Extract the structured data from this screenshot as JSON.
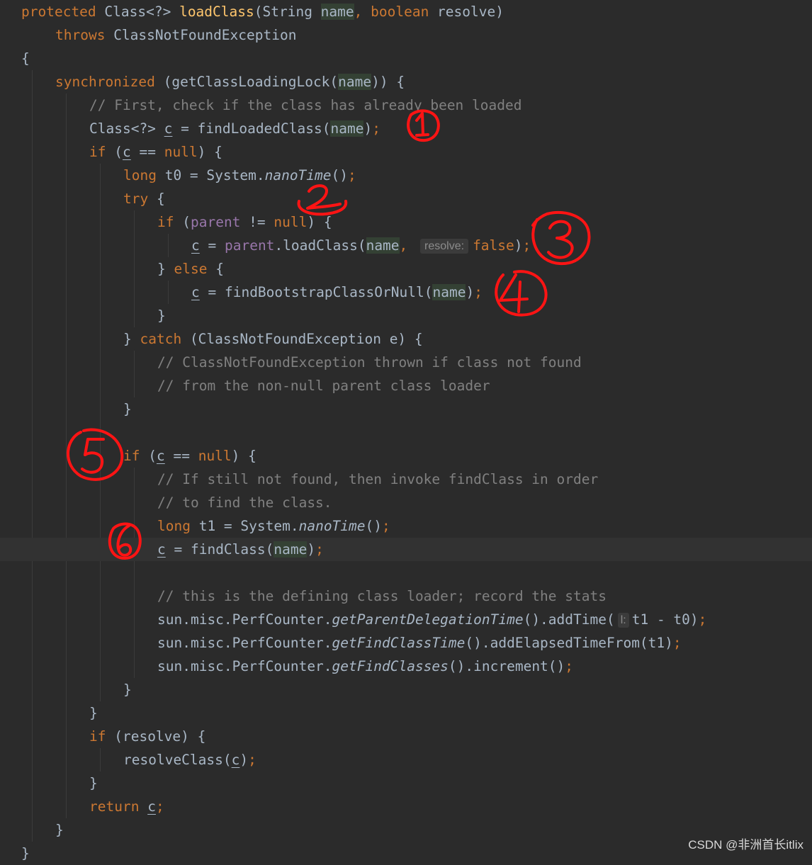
{
  "colors": {
    "background": "#2b2b2b",
    "keyword": "#cc7832",
    "text": "#a9b7c6",
    "method_decl": "#ffc66d",
    "field": "#9876aa",
    "comment": "#808080",
    "param_highlight": "#344134",
    "annotation_ink": "#ff1414"
  },
  "code_lines": [
    {
      "indent": 0,
      "tokens": [
        {
          "t": "protected ",
          "c": "keyword"
        },
        {
          "t": "Class<?> ",
          "c": "text"
        },
        {
          "t": "loadClass",
          "c": "method_decl"
        },
        {
          "t": "(String ",
          "c": "text"
        },
        {
          "t": "name",
          "c": "text",
          "param": true
        },
        {
          "t": ", ",
          "c": "keyword"
        },
        {
          "t": "boolean ",
          "c": "keyword"
        },
        {
          "t": "resolve)",
          "c": "text"
        }
      ]
    },
    {
      "indent": 1,
      "tokens": [
        {
          "t": "throws ",
          "c": "keyword"
        },
        {
          "t": "ClassNotFoundException",
          "c": "text"
        }
      ]
    },
    {
      "indent": 0,
      "tokens": [
        {
          "t": "{",
          "c": "text"
        }
      ]
    },
    {
      "indent": 1,
      "tokens": [
        {
          "t": "synchronized ",
          "c": "keyword"
        },
        {
          "t": "(getClassLoadingLock(",
          "c": "text"
        },
        {
          "t": "name",
          "c": "text",
          "param": true
        },
        {
          "t": ")) {",
          "c": "text"
        }
      ]
    },
    {
      "indent": 2,
      "tokens": [
        {
          "t": "// First, check if the class has already been loaded",
          "c": "comment"
        }
      ]
    },
    {
      "indent": 2,
      "tokens": [
        {
          "t": "Class<?> ",
          "c": "text"
        },
        {
          "t": "c",
          "c": "text",
          "underline": true
        },
        {
          "t": " = findLoadedClass(",
          "c": "text"
        },
        {
          "t": "name",
          "c": "text",
          "param": true
        },
        {
          "t": ")",
          "c": "text"
        },
        {
          "t": ";",
          "c": "keyword"
        }
      ]
    },
    {
      "indent": 2,
      "tokens": [
        {
          "t": "if ",
          "c": "keyword"
        },
        {
          "t": "(",
          "c": "text"
        },
        {
          "t": "c",
          "c": "text",
          "underline": true
        },
        {
          "t": " == ",
          "c": "text"
        },
        {
          "t": "null",
          "c": "keyword"
        },
        {
          "t": ") {",
          "c": "text"
        }
      ]
    },
    {
      "indent": 3,
      "tokens": [
        {
          "t": "long ",
          "c": "keyword"
        },
        {
          "t": "t0 = System.",
          "c": "text"
        },
        {
          "t": "nanoTime",
          "c": "text",
          "italic": true
        },
        {
          "t": "()",
          "c": "text"
        },
        {
          "t": ";",
          "c": "keyword"
        }
      ]
    },
    {
      "indent": 3,
      "tokens": [
        {
          "t": "try ",
          "c": "keyword"
        },
        {
          "t": "{",
          "c": "text"
        }
      ]
    },
    {
      "indent": 4,
      "tokens": [
        {
          "t": "if ",
          "c": "keyword"
        },
        {
          "t": "(",
          "c": "text"
        },
        {
          "t": "parent",
          "c": "field"
        },
        {
          "t": " != ",
          "c": "text"
        },
        {
          "t": "null",
          "c": "keyword"
        },
        {
          "t": ") {",
          "c": "text"
        }
      ]
    },
    {
      "indent": 5,
      "tokens": [
        {
          "t": "c",
          "c": "text",
          "underline": true
        },
        {
          "t": " = ",
          "c": "text"
        },
        {
          "t": "parent",
          "c": "field"
        },
        {
          "t": ".loadClass(",
          "c": "text"
        },
        {
          "t": "name",
          "c": "text",
          "param": true
        },
        {
          "t": ", ",
          "c": "keyword"
        },
        {
          "t": "resolve:",
          "c": "hint"
        },
        {
          "t": "false",
          "c": "keyword"
        },
        {
          "t": ")",
          "c": "text"
        },
        {
          "t": ";",
          "c": "keyword"
        }
      ]
    },
    {
      "indent": 4,
      "tokens": [
        {
          "t": "} ",
          "c": "text"
        },
        {
          "t": "else ",
          "c": "keyword"
        },
        {
          "t": "{",
          "c": "text"
        }
      ]
    },
    {
      "indent": 5,
      "tokens": [
        {
          "t": "c",
          "c": "text",
          "underline": true
        },
        {
          "t": " = findBootstrapClassOrNull(",
          "c": "text"
        },
        {
          "t": "name",
          "c": "text",
          "param": true
        },
        {
          "t": ")",
          "c": "text"
        },
        {
          "t": ";",
          "c": "keyword"
        }
      ]
    },
    {
      "indent": 4,
      "tokens": [
        {
          "t": "}",
          "c": "text"
        }
      ]
    },
    {
      "indent": 3,
      "tokens": [
        {
          "t": "} ",
          "c": "text"
        },
        {
          "t": "catch ",
          "c": "keyword"
        },
        {
          "t": "(ClassNotFoundException e) {",
          "c": "text"
        }
      ]
    },
    {
      "indent": 4,
      "tokens": [
        {
          "t": "// ClassNotFoundException thrown if class not found",
          "c": "comment"
        }
      ]
    },
    {
      "indent": 4,
      "tokens": [
        {
          "t": "// from the non-null parent class loader",
          "c": "comment"
        }
      ]
    },
    {
      "indent": 3,
      "tokens": [
        {
          "t": "}",
          "c": "text"
        }
      ]
    },
    {
      "indent": 0,
      "tokens": []
    },
    {
      "indent": 3,
      "tokens": [
        {
          "t": "if ",
          "c": "keyword"
        },
        {
          "t": "(",
          "c": "text"
        },
        {
          "t": "c",
          "c": "text",
          "underline": true
        },
        {
          "t": " == ",
          "c": "text"
        },
        {
          "t": "null",
          "c": "keyword"
        },
        {
          "t": ") {",
          "c": "text"
        }
      ]
    },
    {
      "indent": 4,
      "tokens": [
        {
          "t": "// If still not found, then invoke findClass in order",
          "c": "comment"
        }
      ]
    },
    {
      "indent": 4,
      "tokens": [
        {
          "t": "// to find the class.",
          "c": "comment"
        }
      ]
    },
    {
      "indent": 4,
      "tokens": [
        {
          "t": "long ",
          "c": "keyword"
        },
        {
          "t": "t1 = System.",
          "c": "text"
        },
        {
          "t": "nanoTime",
          "c": "text",
          "italic": true
        },
        {
          "t": "()",
          "c": "text"
        },
        {
          "t": ";",
          "c": "keyword"
        }
      ]
    },
    {
      "indent": 4,
      "current": true,
      "tokens": [
        {
          "t": "c",
          "c": "text",
          "underline": true
        },
        {
          "t": " = findClass(",
          "c": "text"
        },
        {
          "t": "name",
          "c": "text",
          "param": true
        },
        {
          "t": ")",
          "c": "text"
        },
        {
          "t": ";",
          "c": "keyword"
        }
      ]
    },
    {
      "indent": 0,
      "tokens": []
    },
    {
      "indent": 4,
      "tokens": [
        {
          "t": "// this is the defining class loader; record the stats",
          "c": "comment"
        }
      ]
    },
    {
      "indent": 4,
      "tokens": [
        {
          "t": "sun.misc.PerfCounter.",
          "c": "text"
        },
        {
          "t": "getParentDelegationTime",
          "c": "text",
          "italic": true
        },
        {
          "t": "().addTime(",
          "c": "text"
        },
        {
          "t": "l:",
          "c": "hint"
        },
        {
          "t": "t1 - t0)",
          "c": "text"
        },
        {
          "t": ";",
          "c": "keyword"
        }
      ]
    },
    {
      "indent": 4,
      "tokens": [
        {
          "t": "sun.misc.PerfCounter.",
          "c": "text"
        },
        {
          "t": "getFindClassTime",
          "c": "text",
          "italic": true
        },
        {
          "t": "().addElapsedTimeFrom(t1)",
          "c": "text"
        },
        {
          "t": ";",
          "c": "keyword"
        }
      ]
    },
    {
      "indent": 4,
      "tokens": [
        {
          "t": "sun.misc.PerfCounter.",
          "c": "text"
        },
        {
          "t": "getFindClasses",
          "c": "text",
          "italic": true
        },
        {
          "t": "().increment()",
          "c": "text"
        },
        {
          "t": ";",
          "c": "keyword"
        }
      ]
    },
    {
      "indent": 3,
      "tokens": [
        {
          "t": "}",
          "c": "text"
        }
      ]
    },
    {
      "indent": 2,
      "tokens": [
        {
          "t": "}",
          "c": "text"
        }
      ]
    },
    {
      "indent": 2,
      "tokens": [
        {
          "t": "if ",
          "c": "keyword"
        },
        {
          "t": "(resolve) {",
          "c": "text"
        }
      ]
    },
    {
      "indent": 3,
      "tokens": [
        {
          "t": "resolveClass(",
          "c": "text"
        },
        {
          "t": "c",
          "c": "text",
          "underline": true
        },
        {
          "t": ")",
          "c": "text"
        },
        {
          "t": ";",
          "c": "keyword"
        }
      ]
    },
    {
      "indent": 2,
      "tokens": [
        {
          "t": "}",
          "c": "text"
        }
      ]
    },
    {
      "indent": 2,
      "tokens": [
        {
          "t": "return ",
          "c": "keyword"
        },
        {
          "t": "c",
          "c": "text",
          "underline": true
        },
        {
          "t": ";",
          "c": "keyword"
        }
      ]
    },
    {
      "indent": 1,
      "tokens": [
        {
          "t": "}",
          "c": "text"
        }
      ]
    },
    {
      "indent": 0,
      "tokens": [
        {
          "t": "}",
          "c": "text"
        }
      ]
    }
  ],
  "annotations": [
    {
      "label": "1",
      "shape": "digit-one-circled"
    },
    {
      "label": "2",
      "shape": "digit-two"
    },
    {
      "label": "3",
      "shape": "digit-three-circled"
    },
    {
      "label": "4",
      "shape": "digit-four-circled"
    },
    {
      "label": "5",
      "shape": "digit-five-circled"
    },
    {
      "label": "6",
      "shape": "digit-six-circled"
    }
  ],
  "watermark": "CSDN @非洲首长itlix"
}
